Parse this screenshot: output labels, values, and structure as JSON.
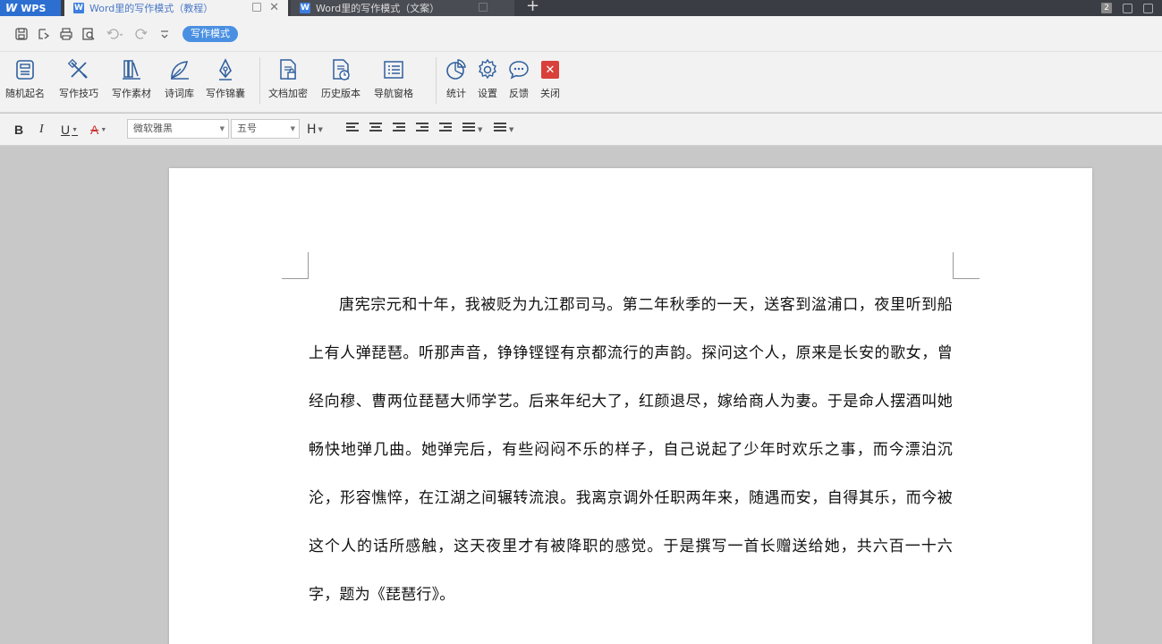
{
  "titlebar": {
    "app_name": "WPS",
    "tabs": [
      {
        "label": "Word里的写作模式（教程）",
        "active": true
      },
      {
        "label": "Word里的写作模式（文案）",
        "active": false
      }
    ],
    "window_count": "2"
  },
  "quickbar": {
    "mode_label": "写作模式"
  },
  "ribbon": {
    "items": [
      {
        "label": "随机起名",
        "icon": "random-name-icon"
      },
      {
        "label": "写作技巧",
        "icon": "writing-tips-icon"
      },
      {
        "label": "写作素材",
        "icon": "writing-material-icon"
      },
      {
        "label": "诗词库",
        "icon": "poetry-library-icon"
      },
      {
        "label": "写作锦囊",
        "icon": "writing-kit-icon"
      },
      {
        "label": "文档加密",
        "icon": "document-encrypt-icon"
      },
      {
        "label": "历史版本",
        "icon": "history-version-icon"
      },
      {
        "label": "导航窗格",
        "icon": "navigation-pane-icon"
      },
      {
        "label": "统计",
        "icon": "statistics-icon"
      },
      {
        "label": "设置",
        "icon": "settings-icon"
      },
      {
        "label": "反馈",
        "icon": "feedback-icon"
      },
      {
        "label": "关闭",
        "icon": "close-icon"
      }
    ]
  },
  "format": {
    "bold": "B",
    "italic": "I",
    "underline": "U",
    "font_color": "A",
    "font_name": "微软雅黑",
    "font_size": "五号",
    "heading": "H"
  },
  "document": {
    "paragraph": "唐宪宗元和十年，我被贬为九江郡司马。第二年秋季的一天，送客到湓浦口，夜里听到船上有人弹琵琶。听那声音，铮铮铿铿有京都流行的声韵。探问这个人，原来是长安的歌女，曾经向穆、曹两位琵琶大师学艺。后来年纪大了，红颜退尽，嫁给商人为妻。于是命人摆酒叫她畅快地弹几曲。她弹完后，有些闷闷不乐的样子，自己说起了少年时欢乐之事，而今漂泊沉沦，形容憔悴，在江湖之间辗转流浪。我离京调外任职两年来，随遇而安，自得其乐，而今被这个人的话所感触，这天夜里才有被降职的感觉。于是撰写一首长赠送给她，共六百一十六字，题为《琵琶行》。"
  },
  "colors": {
    "accent": "#4a90e2",
    "close_red": "#d9403a",
    "titlebar": "#3b3d44"
  }
}
